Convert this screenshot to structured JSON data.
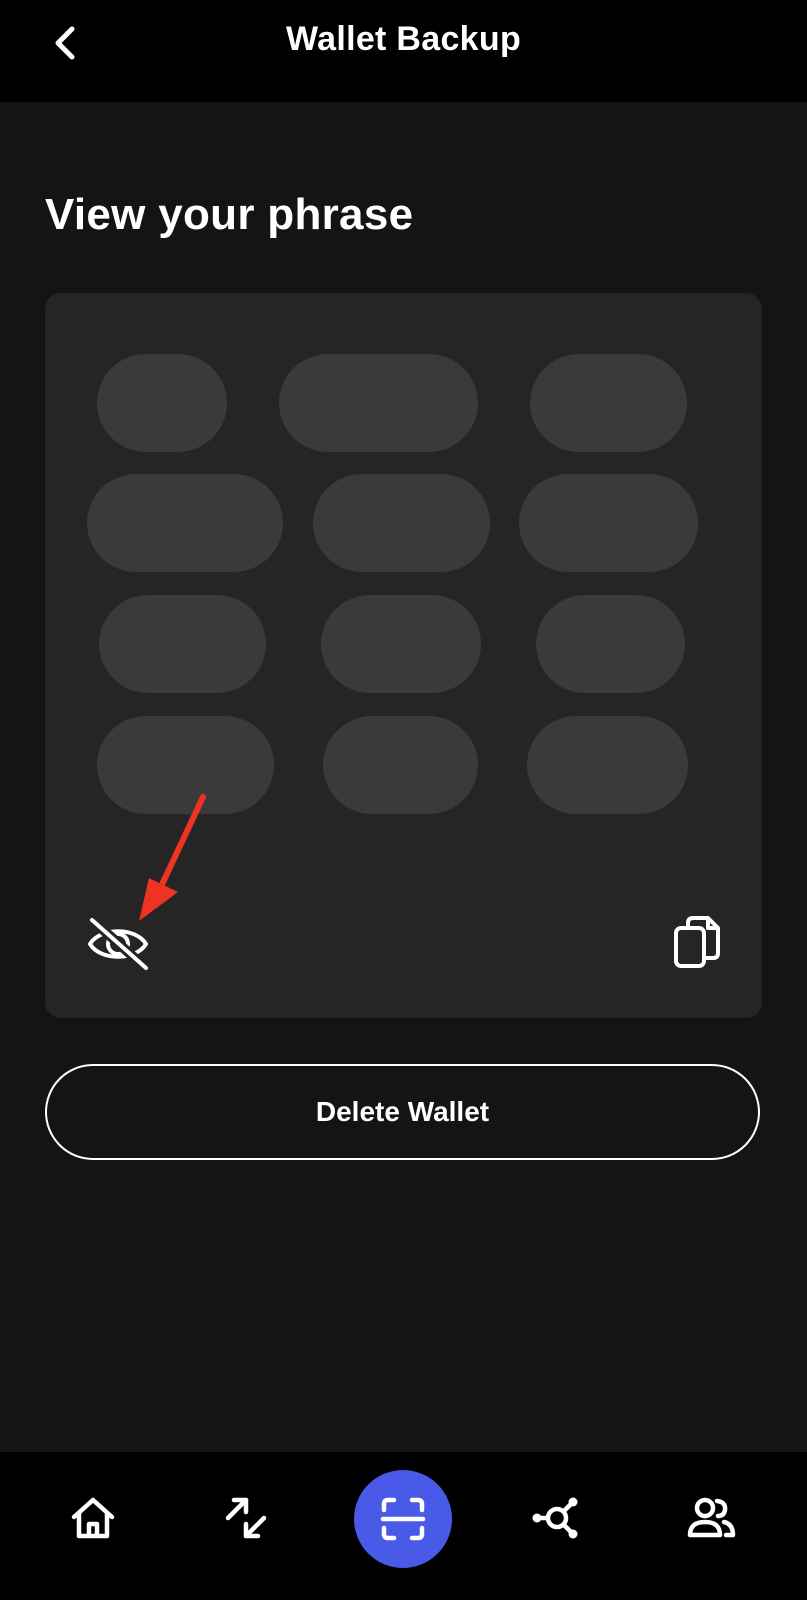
{
  "header": {
    "title": "Wallet Backup",
    "back_icon": "chevron-left-icon"
  },
  "section": {
    "title": "View your phrase"
  },
  "phrase_card": {
    "word_count": 12,
    "words_hidden": true,
    "toggle_icon": "eye-off-icon",
    "copy_icon": "copy-icon"
  },
  "actions": {
    "delete_label": "Delete Wallet"
  },
  "bottom_nav": {
    "items": [
      {
        "icon": "home-icon"
      },
      {
        "icon": "swap-icon"
      },
      {
        "icon": "scan-icon",
        "active": true
      },
      {
        "icon": "network-icon"
      },
      {
        "icon": "users-icon"
      }
    ]
  },
  "colors": {
    "background": "#141414",
    "bar": "#000000",
    "card": "#252525",
    "pill": "#3a3a3a",
    "accent": "#4a5ae8",
    "annotation": "#ee3322"
  }
}
